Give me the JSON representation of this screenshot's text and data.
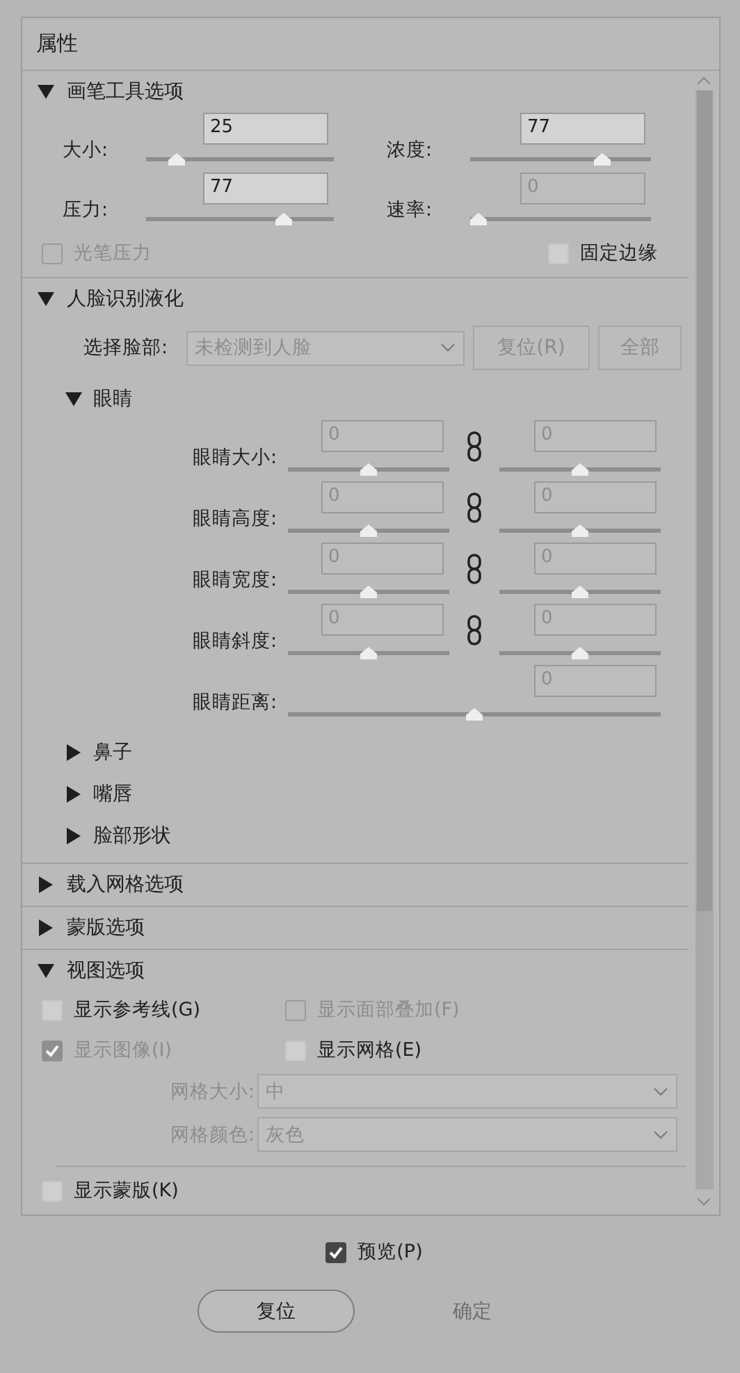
{
  "panel": {
    "title": "属性"
  },
  "sections": [
    {
      "kind": "brush",
      "title": "画笔工具选项",
      "expanded": true,
      "sliders": [
        {
          "label": "大小:",
          "value": "25",
          "level": 0.13,
          "disabled": false
        },
        {
          "label": "浓度:",
          "value": "77",
          "level": 0.75,
          "disabled": false
        },
        {
          "label": "压力:",
          "value": "77",
          "level": 0.76,
          "disabled": false
        },
        {
          "label": "速率:",
          "value": "0",
          "level": 0.0,
          "disabled": true
        }
      ],
      "checkboxes": [
        {
          "label": "光笔压力",
          "checked": false,
          "disabled": true
        },
        {
          "label": "固定边缘",
          "checked": false,
          "disabled": false
        }
      ]
    },
    {
      "kind": "face",
      "title": "人脸识别液化",
      "expanded": true,
      "select_face": {
        "label": "选择脸部:",
        "value": "未检测到人脸",
        "disabled": true
      },
      "buttons": [
        {
          "label": "复位(R)",
          "disabled": true
        },
        {
          "label": "全部",
          "disabled": true
        }
      ],
      "groups": [
        {
          "title": "眼睛",
          "expanded": true,
          "rows": [
            {
              "label": "眼睛大小:",
              "linked": true,
              "left": {
                "value": "0",
                "level": 0.5
              },
              "right": {
                "value": "0",
                "level": 0.5
              }
            },
            {
              "label": "眼睛高度:",
              "linked": true,
              "left": {
                "value": "0",
                "level": 0.5
              },
              "right": {
                "value": "0",
                "level": 0.5
              }
            },
            {
              "label": "眼睛宽度:",
              "linked": true,
              "left": {
                "value": "0",
                "level": 0.5
              },
              "right": {
                "value": "0",
                "level": 0.5
              }
            },
            {
              "label": "眼睛斜度:",
              "linked": true,
              "left": {
                "value": "0",
                "level": 0.5
              },
              "right": {
                "value": "0",
                "level": 0.5
              }
            },
            {
              "label": "眼睛距离:",
              "value": "0",
              "level": 0.5
            }
          ]
        },
        {
          "title": "鼻子",
          "expanded": false
        },
        {
          "title": "嘴唇",
          "expanded": false
        },
        {
          "title": "脸部形状",
          "expanded": false
        }
      ]
    },
    {
      "kind": "plain",
      "title": "载入网格选项",
      "expanded": false
    },
    {
      "kind": "plain",
      "title": "蒙版选项",
      "expanded": false
    },
    {
      "kind": "view",
      "title": "视图选项",
      "expanded": true,
      "checkboxes": [
        {
          "label": "显示参考线(G)",
          "checked": false,
          "disabled": false
        },
        {
          "label": "显示面部叠加(F)",
          "checked": false,
          "disabled": true
        },
        {
          "label": "显示图像(I)",
          "checked": true,
          "disabled": true
        },
        {
          "label": "显示网格(E)",
          "checked": false,
          "disabled": false
        }
      ],
      "dropdowns": [
        {
          "label": "网格大小:",
          "value": "中",
          "disabled": true
        },
        {
          "label": "网格颜色:",
          "value": "灰色",
          "disabled": true
        }
      ],
      "mask_checkbox": {
        "label": "显示蒙版(K)",
        "checked": false,
        "disabled": false
      }
    }
  ],
  "preview": {
    "label": "预览(P)",
    "checked": true,
    "disabled": false
  },
  "buttons": [
    {
      "label": "复位",
      "disabled": false
    },
    {
      "label": "确定",
      "disabled": true
    }
  ]
}
